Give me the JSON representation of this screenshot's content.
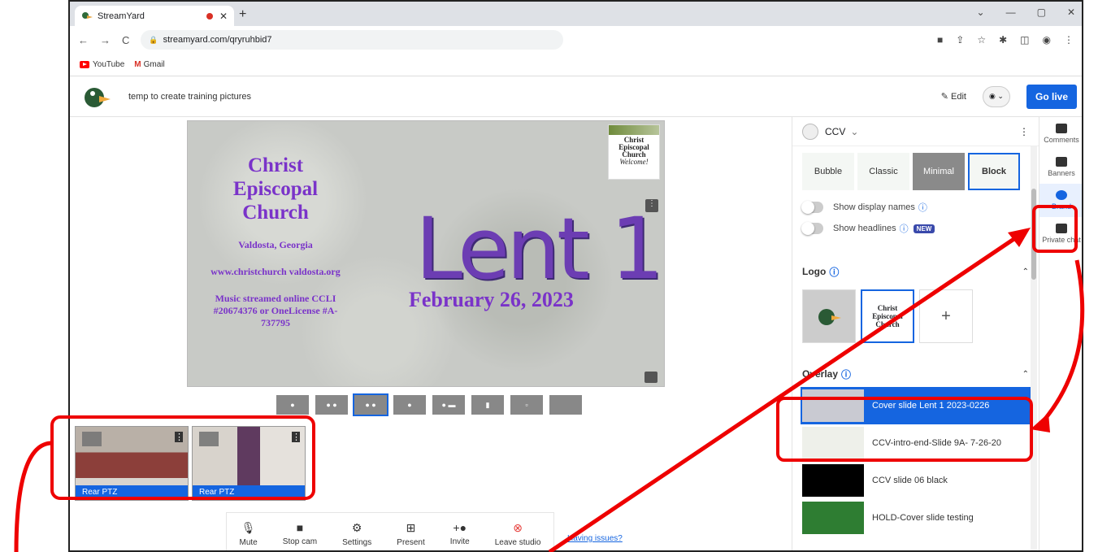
{
  "browser": {
    "tab_title": "StreamYard",
    "url": "streamyard.com/qryruhbid7",
    "bookmarks": [
      "YouTube",
      "Gmail"
    ]
  },
  "app": {
    "broadcast_name": "temp to create training pictures",
    "edit_label": "Edit",
    "go_live_label": "Go live"
  },
  "slide": {
    "church_name": "Christ Episcopal Church",
    "city": "Valdosta, Georgia",
    "website": "www.christchurch valdosta.org",
    "music_info": "Music streamed online CCLI #20674376 or OneLicense #A-737795",
    "main_title": "Lent 1",
    "date": "February 26, 2023",
    "logo_text": "Christ Episcopal Church",
    "logo_welcome": "Welcome!"
  },
  "guests": [
    {
      "label": "Rear PTZ"
    },
    {
      "label": "Rear PTZ"
    }
  ],
  "controls": [
    "Mute",
    "Stop cam",
    "Settings",
    "Present",
    "Invite",
    "Leave studio"
  ],
  "issues_link": "Having issues?",
  "panel": {
    "brand_name": "CCV",
    "styles": [
      "Bubble",
      "Classic",
      "Minimal",
      "Block"
    ],
    "show_display_names": "Show display names",
    "show_headlines": "Show headlines",
    "new_badge": "NEW",
    "logo_section": "Logo",
    "overlay_section": "Overlay",
    "overlays": [
      "Cover slide Lent 1 2023-0226",
      "CCV-intro-end-Slide 9A- 7-26-20",
      "CCV slide 06 black",
      "HOLD-Cover slide testing"
    ]
  },
  "rail": [
    "Comments",
    "Banners",
    "Brand",
    "Private chat"
  ]
}
